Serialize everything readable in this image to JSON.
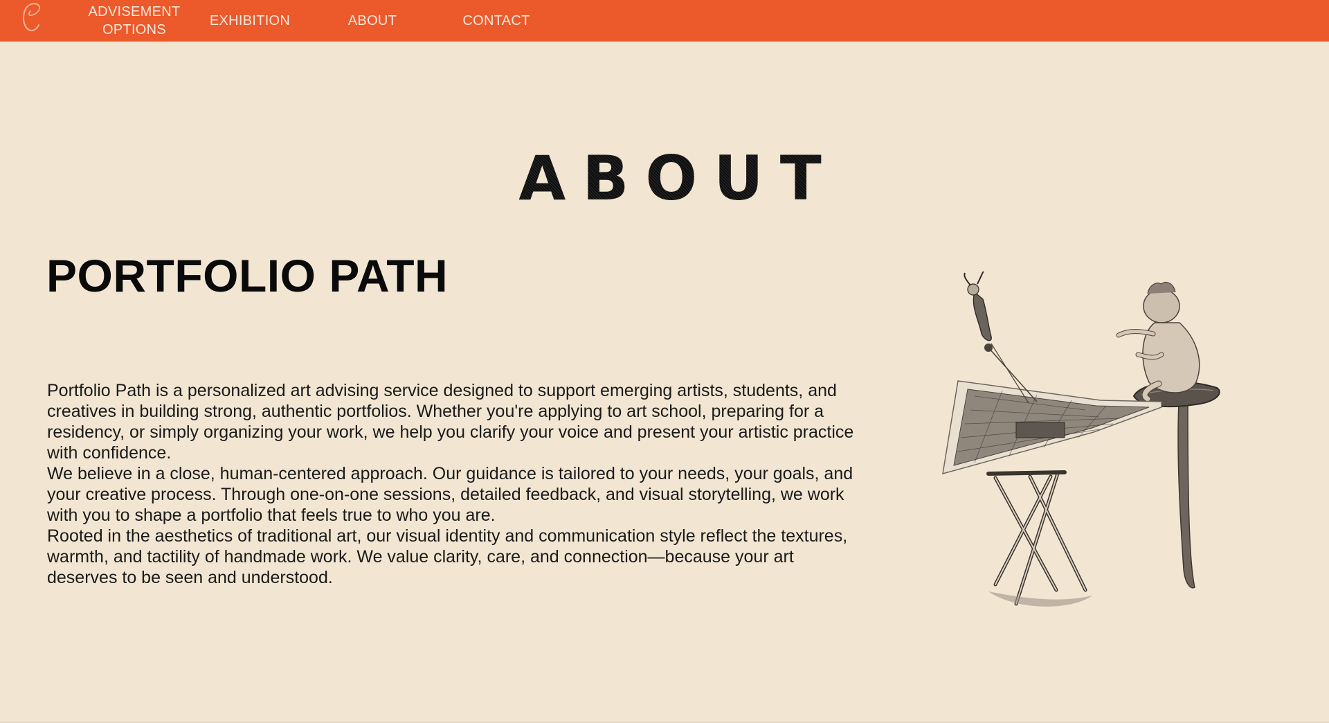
{
  "navbar": {
    "bg_color": "#ec592a",
    "logo_icon": "script-c-logo-icon",
    "items": [
      {
        "label": "ADVISEMENT\nOPTIONS"
      },
      {
        "label": "EXHIBITION"
      },
      {
        "label": "ABOUT"
      },
      {
        "label": "CONTACT"
      }
    ]
  },
  "page": {
    "bg_color": "#f2e6d2",
    "title": "ABOUT",
    "brand_heading": "PORTFOLIO PATH",
    "paragraphs": [
      "Portfolio Path is a personalized art advising service designed to support emerging artists, students, and creatives in building strong, authentic portfolios. Whether you're applying to art school, preparing for a residency, or simply organizing your work, we help you clarify your voice and present your artistic practice with confidence.",
      "We believe in a close, human-centered approach. Our guidance is tailored to your needs, your goals, and your creative process. Through one-on-one sessions, detailed feedback, and visual storytelling, we work with you to shape a portfolio that feels true to who you are.",
      "Rooted in the aesthetics of traditional art, our visual identity and communication style reflect the textures, warmth, and tactility of handmade work. We value clarity, care, and connection—because your art deserves to be seen and understood."
    ],
    "illustration_icon": "vintage-collage-easel-illustration"
  }
}
